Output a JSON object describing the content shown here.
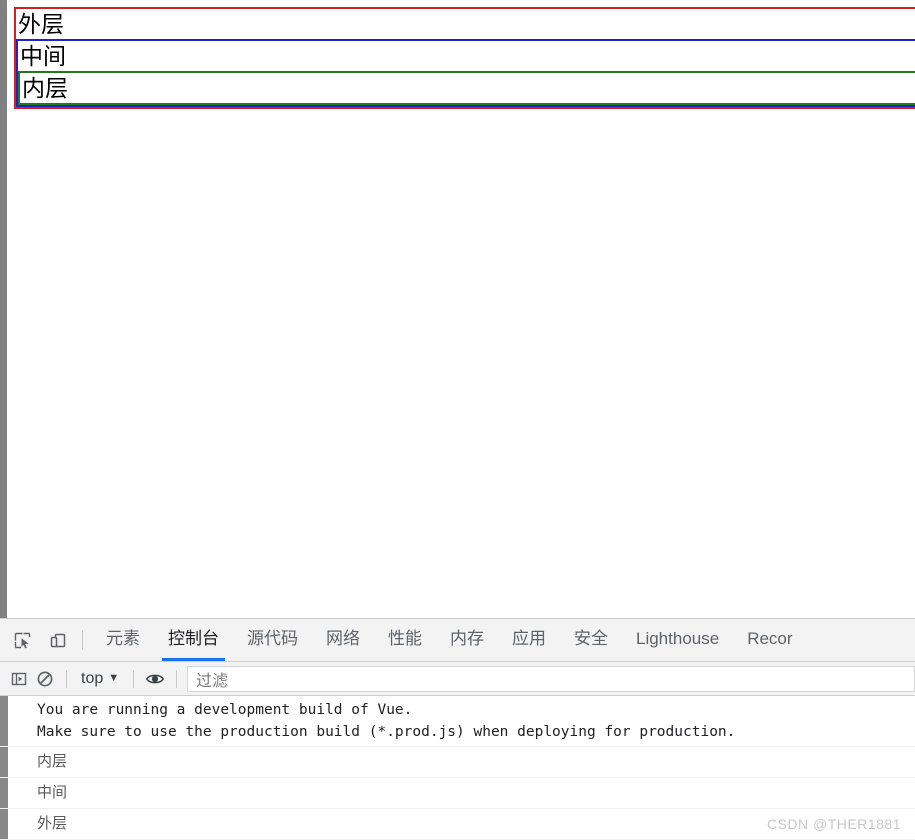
{
  "page": {
    "boxes": {
      "outer_label": "外层",
      "middle_label": "中间",
      "inner_label": "内层",
      "outer_border_color": "#d32020",
      "middle_border_color": "#2020cc",
      "inner_border_color": "#1f7a1f"
    }
  },
  "devtools": {
    "tabs": [
      {
        "label": "元素",
        "active": false
      },
      {
        "label": "控制台",
        "active": true
      },
      {
        "label": "源代码",
        "active": false
      },
      {
        "label": "网络",
        "active": false
      },
      {
        "label": "性能",
        "active": false
      },
      {
        "label": "内存",
        "active": false
      },
      {
        "label": "应用",
        "active": false
      },
      {
        "label": "安全",
        "active": false
      },
      {
        "label": "Lighthouse",
        "active": false
      },
      {
        "label": "Recor",
        "active": false
      }
    ],
    "toolbar_icons": {
      "inspect": "inspect-element-icon",
      "device": "device-toolbar-icon"
    },
    "console_toolbar": {
      "sidebar_toggle": "console-sidebar-icon",
      "clear": "clear-console-icon",
      "context": "top",
      "context_caret": "▼",
      "eye": "live-expression-icon",
      "filter_placeholder": "过滤"
    },
    "messages": [
      {
        "kind": "mono",
        "text": "You are running a development build of Vue.\nMake sure to use the production build (*.prod.js) when deploying for production."
      },
      {
        "kind": "log",
        "text": "内层"
      },
      {
        "kind": "log",
        "text": "中间"
      },
      {
        "kind": "log",
        "text": "外层"
      }
    ]
  },
  "watermark": {
    "text": "CSDN @THER1881"
  },
  "colors": {
    "accent": "#1a73e8",
    "tabbar_bg": "#f3f3f3",
    "console_bg": "#ffffff",
    "gutter": "#808080"
  }
}
